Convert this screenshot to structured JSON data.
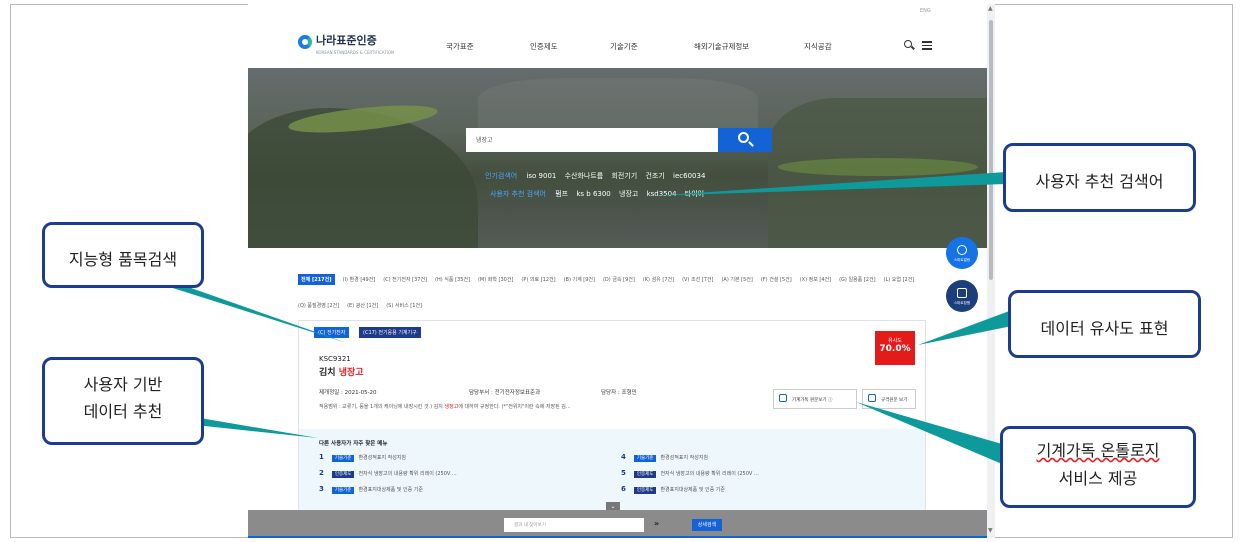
{
  "site": {
    "logo_text": "나라표준인증",
    "logo_sub": "KOREAN STANDARDS & CERTIFICATION",
    "corner_tag": "ENG",
    "menu": [
      "국가표준",
      "인증제도",
      "기술기준",
      "해외기술규제정보",
      "지식공감"
    ]
  },
  "search": {
    "value": "냉장고",
    "popular_label": "인기검색어",
    "popular": [
      "iso 9001",
      "수산화나트륨",
      "회전기기",
      "건조기",
      "iec60034"
    ],
    "recommend_label": "사용자 추천 검색어",
    "recommend": [
      "펌프",
      "ks b 6300",
      "냉장고",
      "ksd3504",
      "타이어"
    ]
  },
  "categories": [
    {
      "label": "전체 [217건]",
      "active": true
    },
    {
      "label": "(I) 환경 [49건]"
    },
    {
      "label": "(C) 전기전자 [37건]"
    },
    {
      "label": "(H) 식품 [35건]"
    },
    {
      "label": "(M) 화학 [30건]"
    },
    {
      "label": "(P) 의료 [12건]"
    },
    {
      "label": "(B) 기계 [9건]"
    },
    {
      "label": "(D) 금속 [9건]"
    },
    {
      "label": "(K) 섬유 [7건]"
    },
    {
      "label": "(V) 조선 [7건]"
    },
    {
      "label": "(A) 기본 [5건]"
    },
    {
      "label": "(F) 건설 [5건]"
    },
    {
      "label": "(X) 정보 [4건]"
    },
    {
      "label": "(G) 일용품 [2건]"
    },
    {
      "label": "(L) 요업 [2건]"
    },
    {
      "label": "(Q) 품질경영 [2건]"
    },
    {
      "label": "(E) 광산 [1건]"
    },
    {
      "label": "(S) 서비스 [1건]"
    }
  ],
  "result": {
    "tags": [
      "(C) 전기전자",
      "(C17) 전기응용 기계기구"
    ],
    "code": "KSC9321",
    "title_prefix": "김치 ",
    "title_highlight": "냉장고",
    "similarity_label": "유사도",
    "similarity": "70.0%",
    "date": "제개정일 : 2021-05-20",
    "dept": "담당부서 : 전기전자정보표준과",
    "manager": "담당자 : 조형민",
    "desc_prefix": "적용범위 :    교류기, 등을 1개의 케이닝에 내장시킨 것.) 김치 ",
    "desc_highlight": "냉장고",
    "desc_suffix": "에 대하여 규정한다. (*\"전위치\"이란 속에 저장된 김...",
    "btn_ontology": "기계가독 원문보기 ⓘ",
    "btn_doc": "규격원문 보기"
  },
  "recs": {
    "heading": "다른 사용자가 자주 찾은 메뉴",
    "items": [
      {
        "num": "1",
        "tag": "기술기준",
        "text": "환경성적표지 작성지침"
      },
      {
        "num": "2",
        "tag": "인증제도",
        "text": "전자식 냉장고의 내용량 확위 리레이 (250V ..."
      },
      {
        "num": "3",
        "tag": "기술기준",
        "text": "환경표지대상제품 및 인증 기준"
      },
      {
        "num": "4",
        "tag": "기술기준",
        "text": "환경성적표지 작성지침"
      },
      {
        "num": "5",
        "tag": "인증제도",
        "text": "전자식 냉장고의 내용량 확위 리레이 (250V ..."
      },
      {
        "num": "6",
        "tag": "인증제도",
        "text": "환경표지대상제품 및 인증 기준"
      }
    ]
  },
  "bottom": {
    "placeholder": "결과 내 찾아보기",
    "go": "»",
    "detail": "상세검색"
  },
  "fabs": [
    "스마트알람",
    "스마트창원"
  ],
  "callouts": {
    "c1": "사용자 추천 검색어",
    "c2": "지능형 품목검색",
    "c3": "데이터 유사도 표현",
    "c4_line1": "사용자 기반",
    "c4_line2": "데이터 추천",
    "c5_line1": "기계가독 온톨로지",
    "c5_line2": "서비스 제공"
  }
}
